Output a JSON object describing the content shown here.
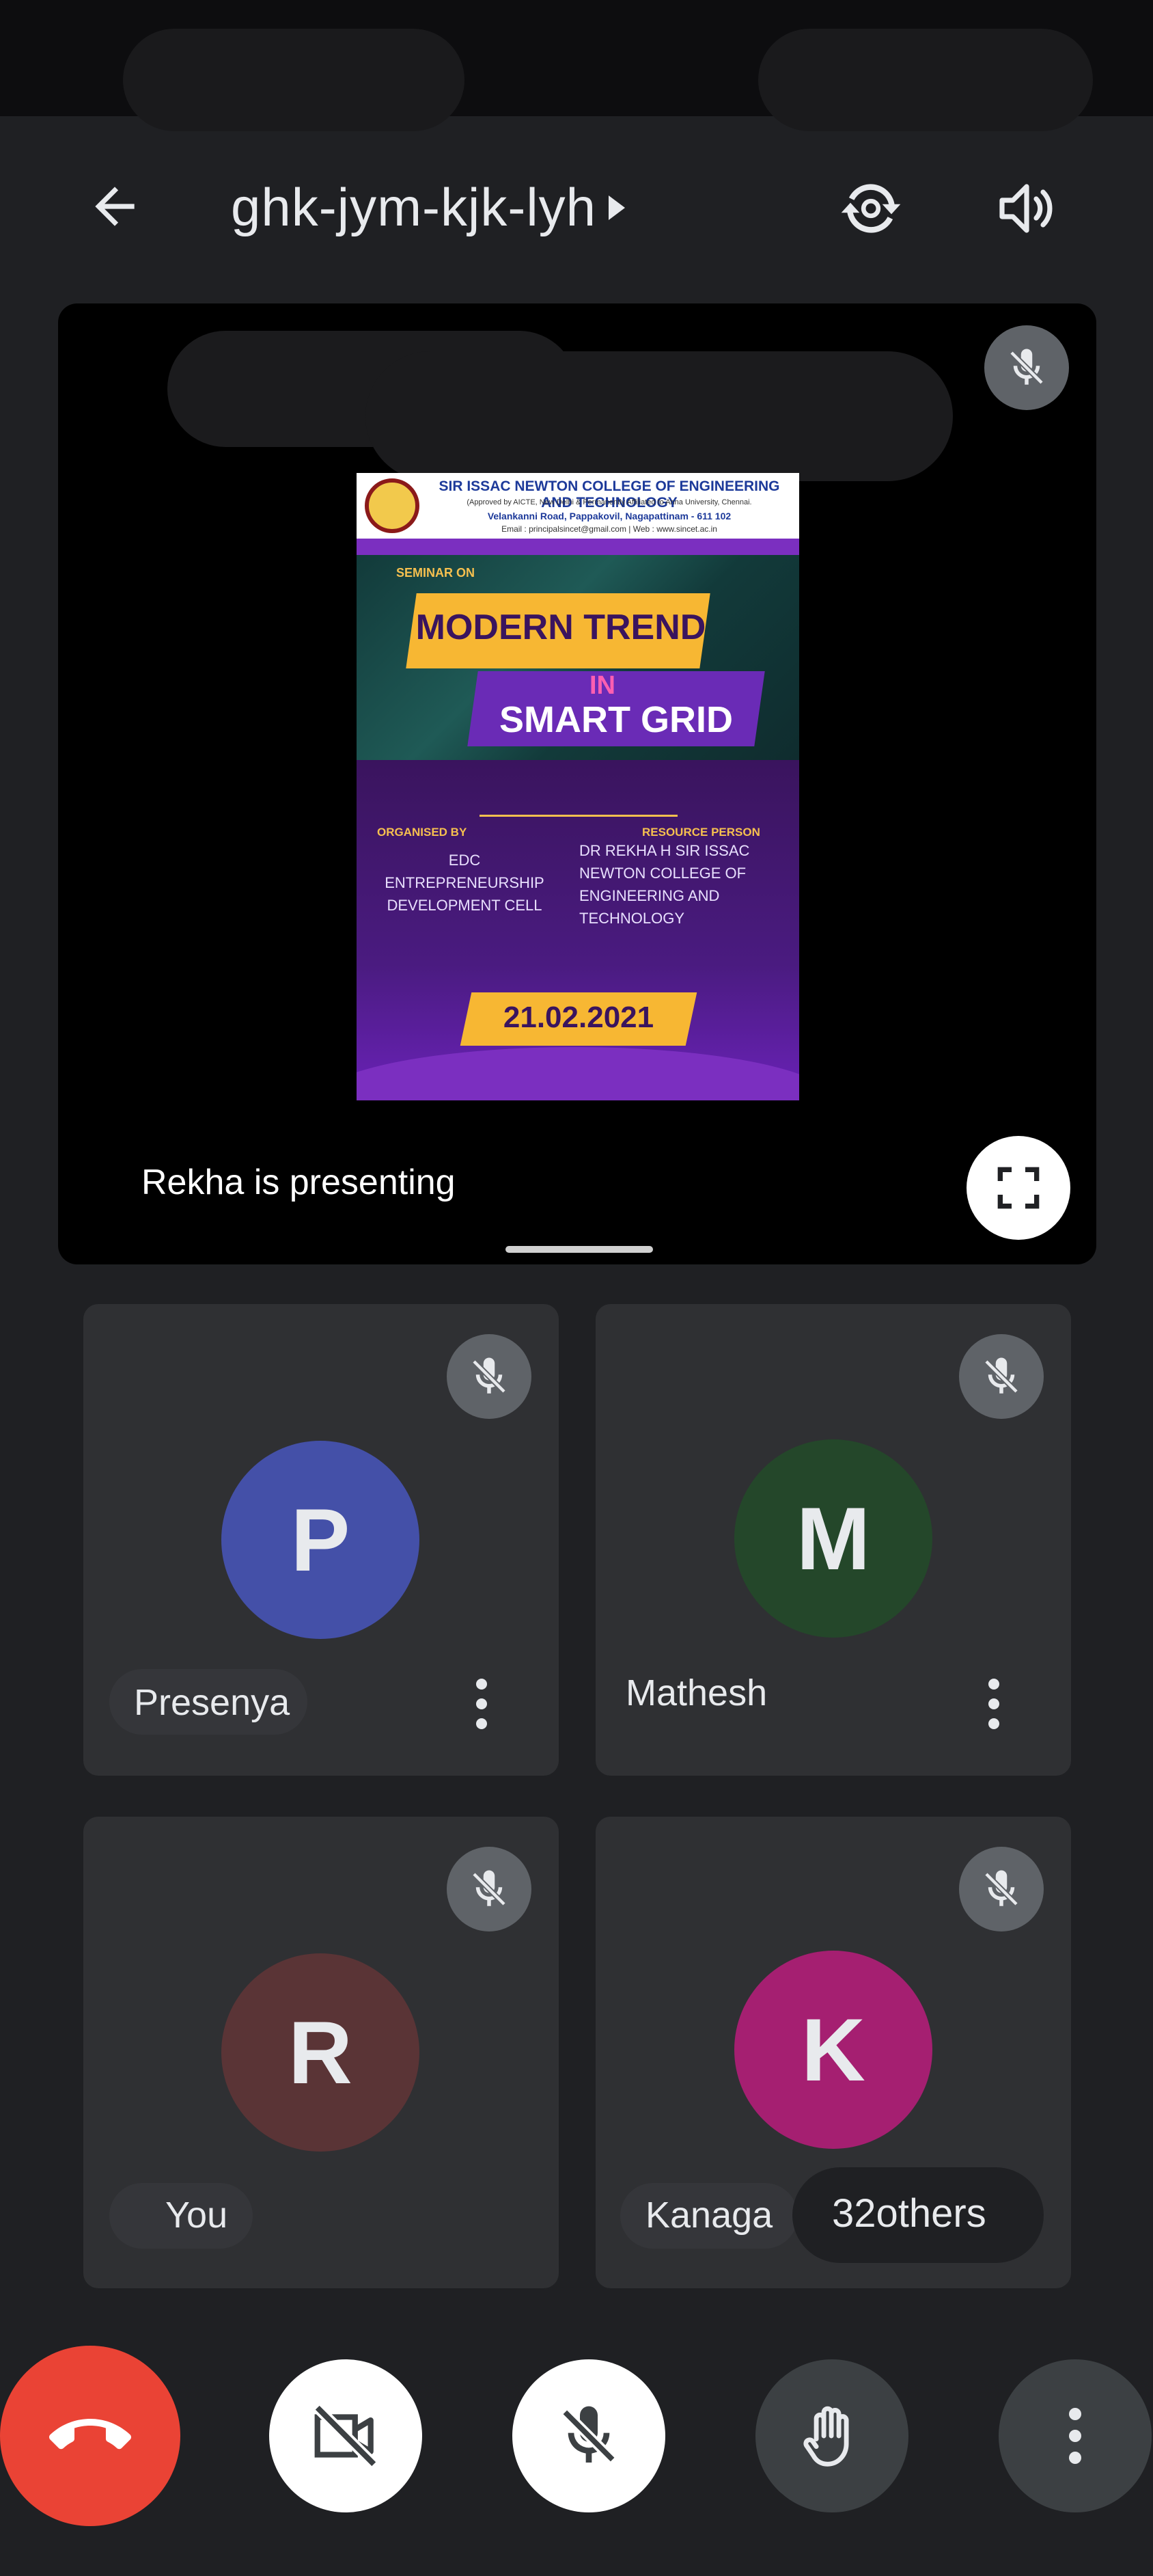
{
  "topbar": {
    "back_label": "Back",
    "meeting_code": "ghk-jym-kjk-lyh"
  },
  "presentation": {
    "presenter_label": "Rekha is presenting",
    "poster": {
      "college": "SIR ISSAC NEWTON COLLEGE OF ENGINEERING AND TECHNOLOGY",
      "approval": "(Approved by AICTE, New Delhi & Permanently Affiliated to Anna University, Chennai.",
      "address": "Velankanni Road, Pappakovil, Nagapattinam - 611 102",
      "email": "Email : principalsincet@gmail.com | Web : www.sincet.ac.in",
      "logo_text": "SINCET",
      "seminar_on": "SEMINAR ON",
      "title_line1": "MODERN TREND",
      "title_in": "IN",
      "title_line2": "SMART GRID",
      "organised_by_label": "ORGANISED BY",
      "organised_by": "EDC ENTREPRENEURSHIP DEVELOPMENT CELL",
      "resource_person_label": "RESOURCE PERSON",
      "resource_person": "DR REKHA H SIR ISSAC NEWTON COLLEGE OF ENGINEERING AND TECHNOLOGY",
      "date": "21.02.2021"
    }
  },
  "participants": [
    {
      "initial": "P",
      "name": "Presenya",
      "color": "#4450a8"
    },
    {
      "initial": "M",
      "name": "Mathesh",
      "color": "#24472a"
    },
    {
      "initial": "R",
      "name": "You",
      "color": "#5a3436"
    },
    {
      "initial": "K",
      "name": "Kanaga",
      "color": "#a51f71"
    }
  ],
  "others": {
    "label": "32others"
  },
  "colors": {
    "background": "#1f2023",
    "tile": "#2f3033",
    "end_call": "#ea4335",
    "mic_badge": "#5f6368"
  }
}
